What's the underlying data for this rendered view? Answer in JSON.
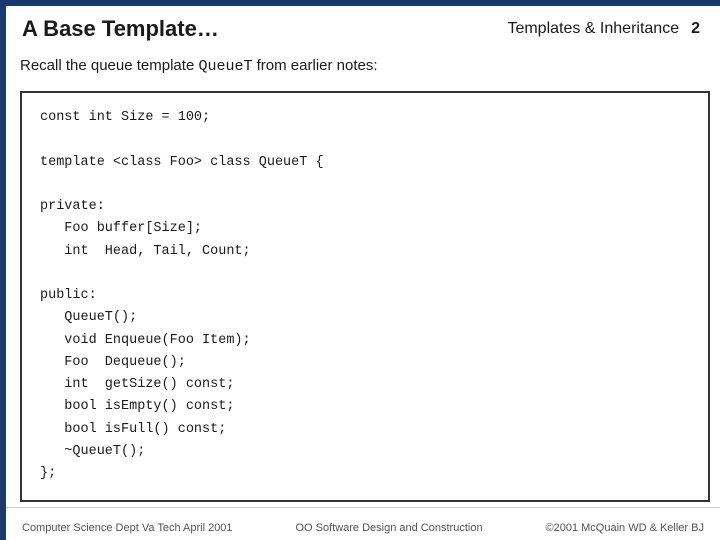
{
  "header": {
    "title": "A Base Template…",
    "section": "Templates & Inheritance",
    "page_number": "2"
  },
  "recall": {
    "text_before": "Recall the queue template ",
    "code_inline": "QueueT",
    "text_after": " from earlier notes:"
  },
  "code": {
    "lines": [
      "const int Size = 100;",
      "",
      "template <class Foo> class QueueT {",
      "",
      "private:",
      "   Foo buffer[Size];",
      "   int  Head, Tail, Count;",
      "",
      "public:",
      "   QueueT();",
      "   void Enqueue(Foo Item);",
      "   Foo  Dequeue();",
      "   int  getSize() const;",
      "   bool isEmpty() const;",
      "   bool isFull() const;",
      "   ~QueueT();",
      "};"
    ]
  },
  "footer": {
    "left": "Computer Science Dept Va Tech April 2001",
    "center": "OO Software Design and Construction",
    "right": "©2001  McQuain WD & Keller BJ"
  }
}
